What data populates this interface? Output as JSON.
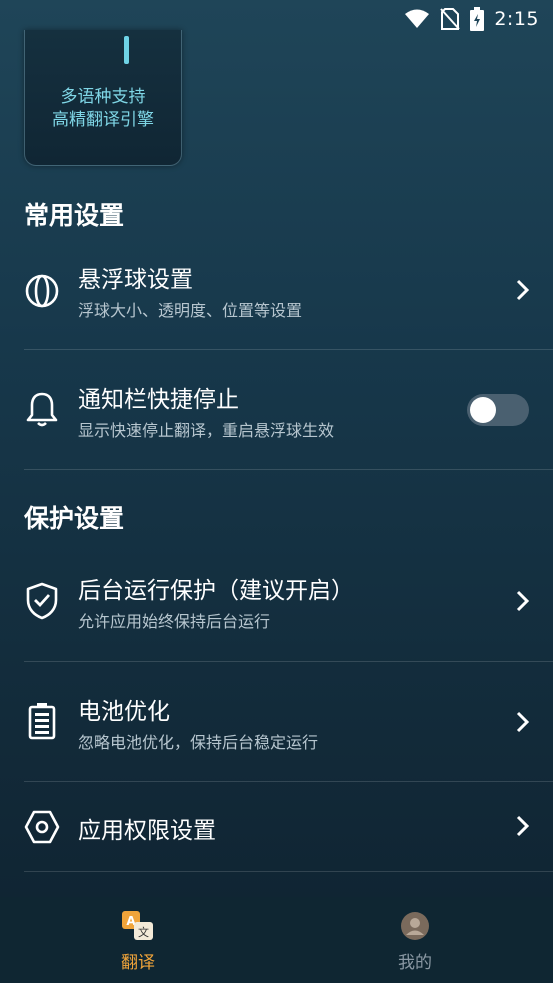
{
  "status_bar": {
    "time": "2:15"
  },
  "promo": {
    "line1": "多语种支持",
    "line2": "高精翻译引擎"
  },
  "sections": {
    "common": "常用设置",
    "protect": "保护设置"
  },
  "items": {
    "float_ball": {
      "title": "悬浮球设置",
      "subtitle": "浮球大小、透明度、位置等设置"
    },
    "notify_stop": {
      "title": "通知栏快捷停止",
      "subtitle": "显示快速停止翻译，重启悬浮球生效",
      "toggle_on": false
    },
    "background": {
      "title": "后台运行保护（建议开启）",
      "subtitle": "允许应用始终保持后台运行"
    },
    "battery": {
      "title": "电池优化",
      "subtitle": "忽略电池优化，保持后台稳定运行"
    },
    "permissions": {
      "title": "应用权限设置"
    }
  },
  "nav": {
    "translate": {
      "label": "翻译",
      "active": true,
      "color": "#f0a43a"
    },
    "mine": {
      "label": "我的",
      "active": false,
      "color": "#8a98a3"
    }
  }
}
